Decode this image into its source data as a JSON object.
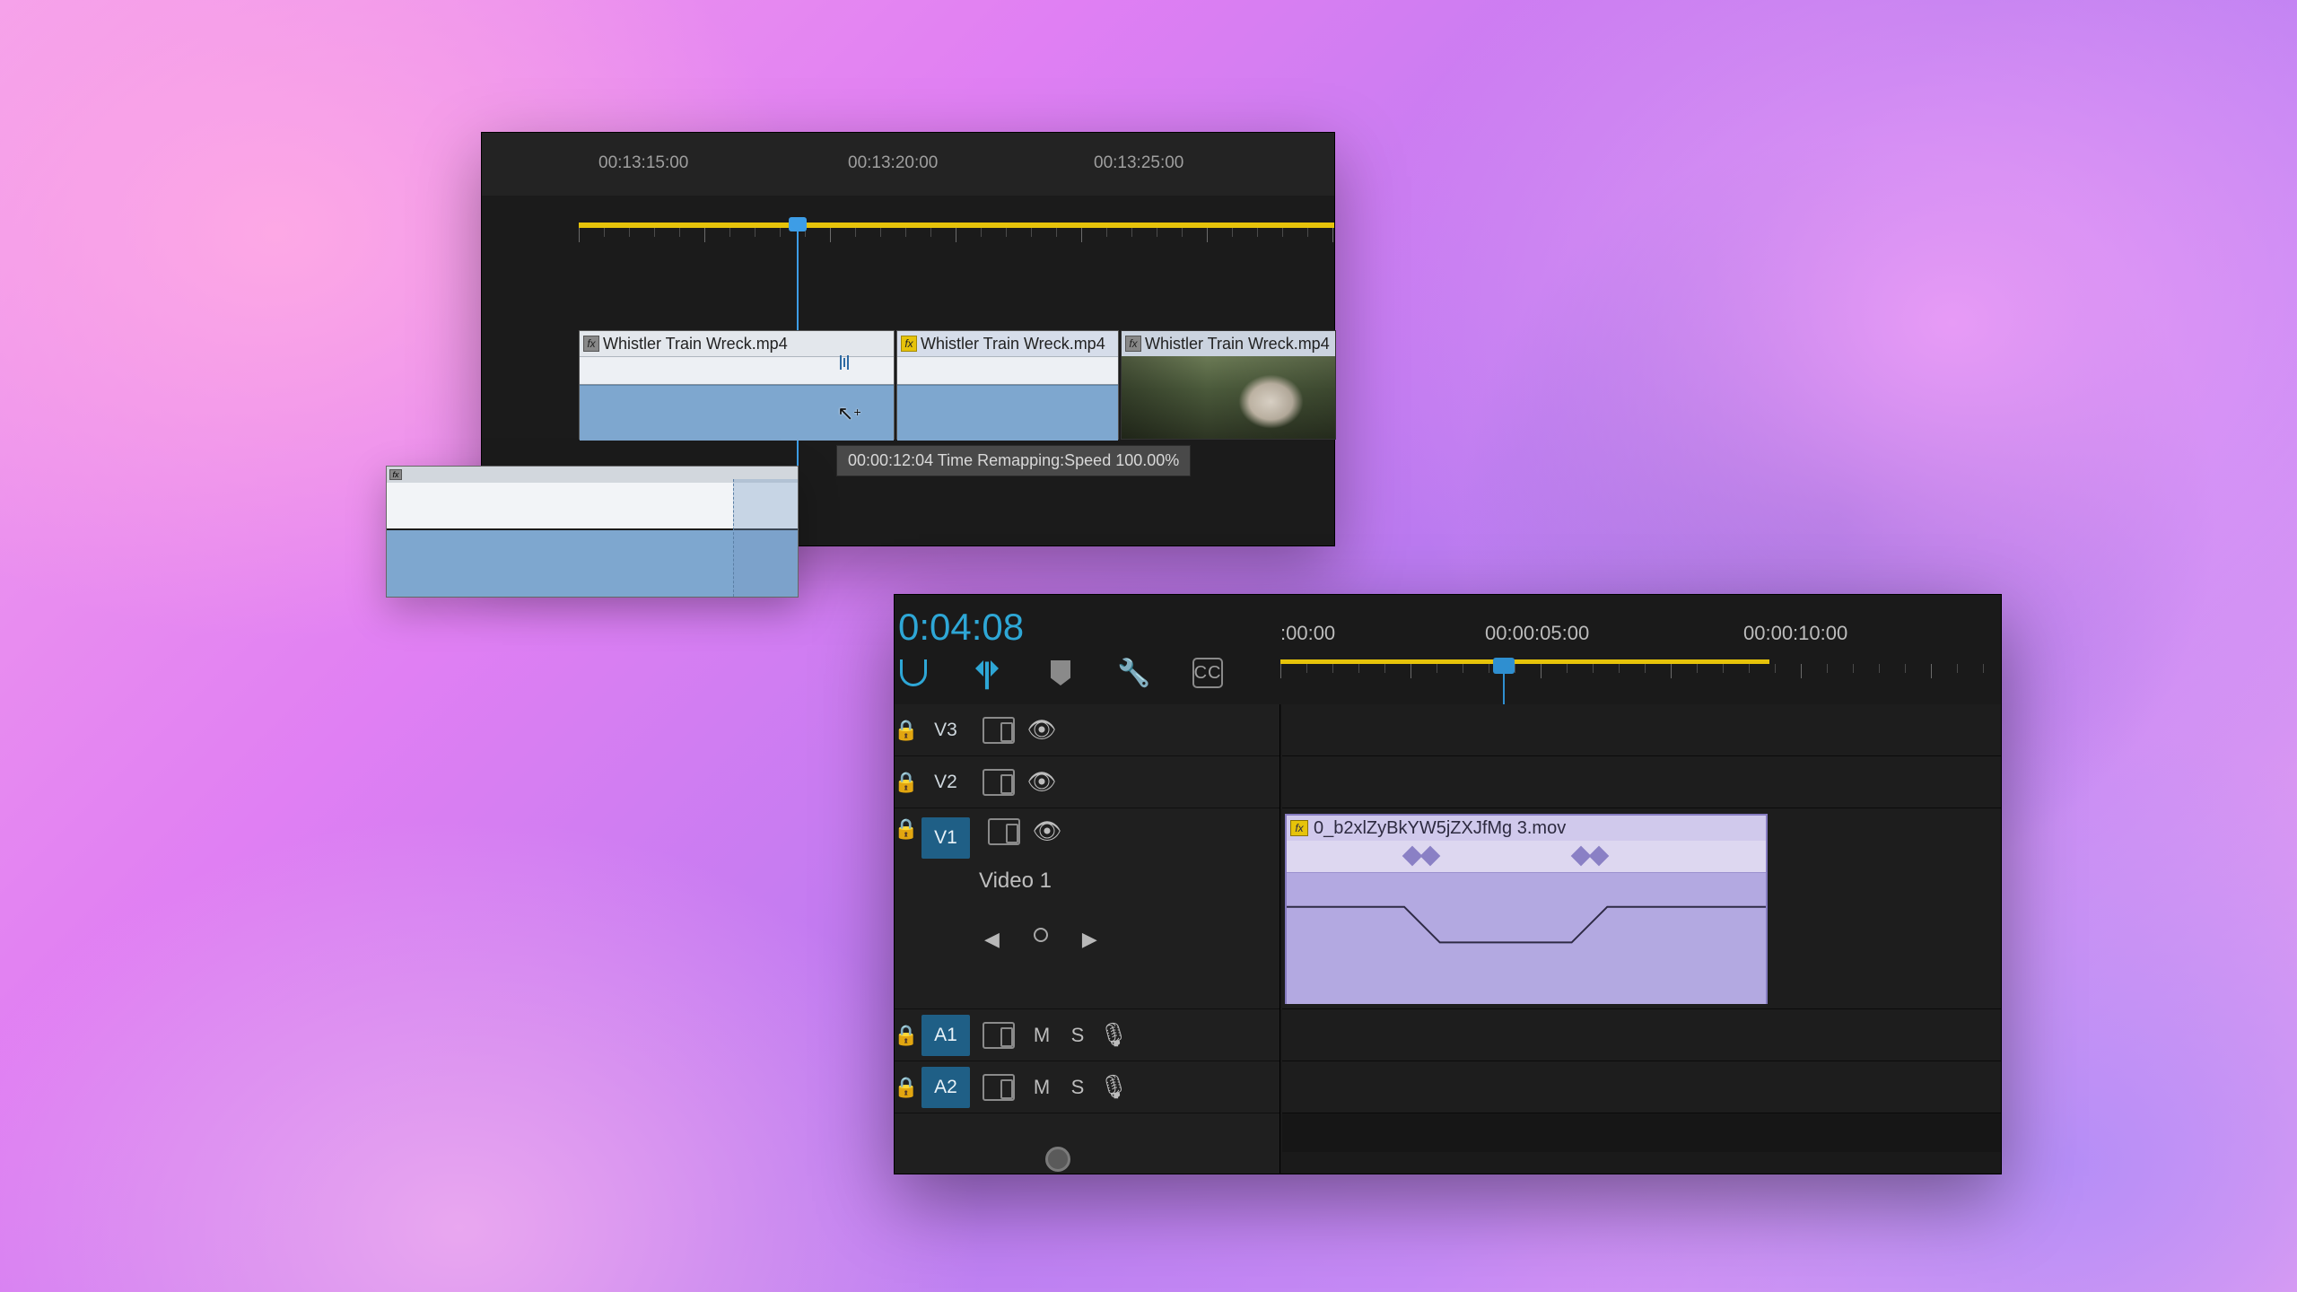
{
  "top": {
    "timecodes": [
      "00:13:15:00",
      "00:13:20:00",
      "00:13:25:00"
    ],
    "clips": [
      {
        "name": "Whistler Train Wreck.mp4",
        "fx": "plain"
      },
      {
        "name": "Whistler Train Wreck.mp4",
        "fx": "yellow"
      },
      {
        "name": "Whistler Train Wreck.mp4",
        "fx": "plain"
      }
    ],
    "tooltip": "00:00:12:04  Time Remapping:Speed  100.00%"
  },
  "bottom": {
    "timecode": "0:04:08",
    "ruler": [
      ":00:00",
      "00:00:05:00",
      "00:00:10:00"
    ],
    "tracks": {
      "v3": "V3",
      "v2": "V2",
      "v1": "V1",
      "v1name": "Video 1",
      "a1": "A1",
      "a2": "A2",
      "mute": "M",
      "solo": "S"
    },
    "clip": {
      "name": "0_b2xlZyBkYW5jZXJfMg 3.mov"
    }
  }
}
